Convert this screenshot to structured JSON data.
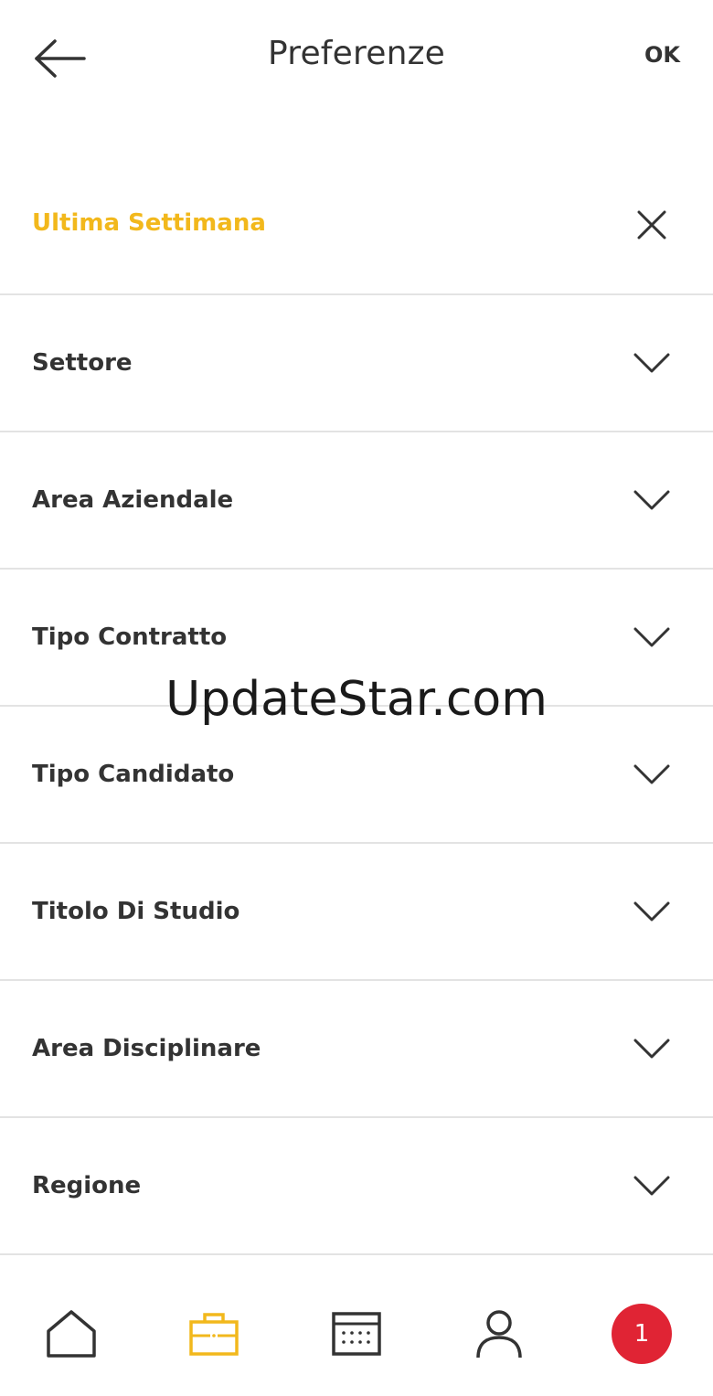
{
  "header": {
    "title": "Preferenze",
    "ok_label": "OK",
    "back_icon": "arrow-left-icon"
  },
  "colors": {
    "accent": "#f2b81c",
    "text": "#333333",
    "divider": "#e3e3e3",
    "badge": "#e02434"
  },
  "filters": [
    {
      "label": "Ultima Settimana",
      "icon": "close-icon",
      "selected": true
    },
    {
      "label": "Settore",
      "icon": "chevron-down-icon"
    },
    {
      "label": "Area Aziendale",
      "icon": "chevron-down-icon"
    },
    {
      "label": "Tipo Contratto",
      "icon": "chevron-down-icon"
    },
    {
      "label": "Tipo Candidato",
      "icon": "chevron-down-icon"
    },
    {
      "label": "Titolo Di Studio",
      "icon": "chevron-down-icon"
    },
    {
      "label": "Area Disciplinare",
      "icon": "chevron-down-icon"
    },
    {
      "label": "Regione",
      "icon": "chevron-down-icon"
    }
  ],
  "watermark": "UpdateStar.com",
  "bottom_nav": {
    "items": [
      {
        "icon": "home-icon"
      },
      {
        "icon": "briefcase-icon",
        "active": true
      },
      {
        "icon": "calendar-icon"
      },
      {
        "icon": "user-icon"
      },
      {
        "icon": "notification-badge",
        "badge_count": "1"
      }
    ]
  }
}
